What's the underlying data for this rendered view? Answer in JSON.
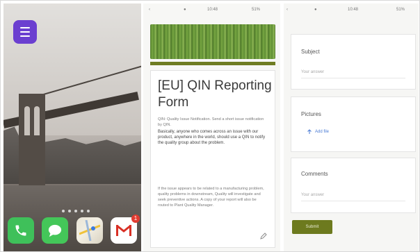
{
  "home": {
    "dock_apps": [
      {
        "name": "phone"
      },
      {
        "name": "messages"
      },
      {
        "name": "maps"
      },
      {
        "name": "gmail",
        "badge": "1"
      }
    ],
    "top_app_icon": "list-icon",
    "accent_color": "#6b3fd0"
  },
  "status_bars": [
    {
      "time": "10:48",
      "battery": "51%"
    },
    {
      "time": "10:48",
      "battery": "51%"
    }
  ],
  "form": {
    "title": "[EU] QIN Reporting Form",
    "intro_1": "QIN: Quality Issue Notification. Send a short issue notification by QIN.",
    "intro_2": "Basically, anyone who comes across an issue with our product, anywhere in the world, should use a QIN to notify the quality group about the problem.",
    "intro_3": "If the issue appears to be related to a manufacturing problem, quality problems in downstream, Quality will investigate and seek preventive actions. A copy of your report will also be routed to Plant Quality Manager.",
    "accent_color": "#6d7a1e"
  },
  "fields": {
    "subject_label": "Subject",
    "subject_placeholder": "Your answer",
    "pictures_label": "Pictures",
    "pictures_action": "Add file",
    "comments_label": "Comments",
    "comments_placeholder": "Your answer",
    "submit_label": "Submit"
  }
}
